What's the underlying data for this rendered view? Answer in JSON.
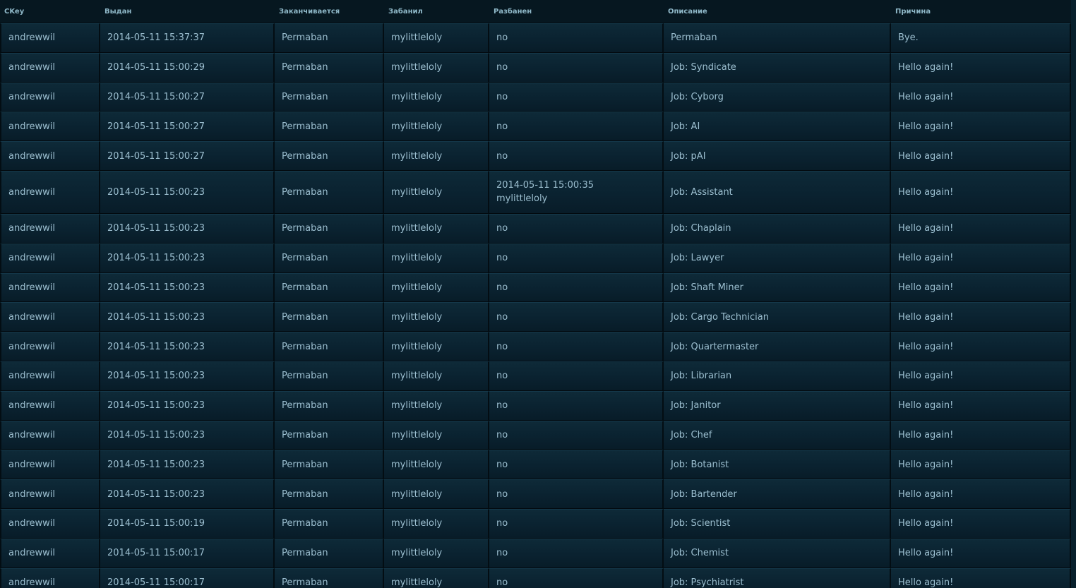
{
  "columns": [
    "CKey",
    "Выдан",
    "Заканчивается",
    "Забанил",
    "Разбанен",
    "Описание",
    "Причина"
  ],
  "rows": [
    {
      "ckey": "andrewwil",
      "issued": "2014-05-11 15:37:37",
      "expires": "Permaban",
      "banned_by": "mylittleloly",
      "unbanned": "no",
      "unbanned_by": "",
      "description": "Permaban",
      "reason": "Bye."
    },
    {
      "ckey": "andrewwil",
      "issued": "2014-05-11 15:00:29",
      "expires": "Permaban",
      "banned_by": "mylittleloly",
      "unbanned": "no",
      "unbanned_by": "",
      "description": "Job: Syndicate",
      "reason": "Hello again!"
    },
    {
      "ckey": "andrewwil",
      "issued": "2014-05-11 15:00:27",
      "expires": "Permaban",
      "banned_by": "mylittleloly",
      "unbanned": "no",
      "unbanned_by": "",
      "description": "Job: Cyborg",
      "reason": "Hello again!"
    },
    {
      "ckey": "andrewwil",
      "issued": "2014-05-11 15:00:27",
      "expires": "Permaban",
      "banned_by": "mylittleloly",
      "unbanned": "no",
      "unbanned_by": "",
      "description": "Job: AI",
      "reason": "Hello again!"
    },
    {
      "ckey": "andrewwil",
      "issued": "2014-05-11 15:00:27",
      "expires": "Permaban",
      "banned_by": "mylittleloly",
      "unbanned": "no",
      "unbanned_by": "",
      "description": "Job: pAI",
      "reason": "Hello again!"
    },
    {
      "ckey": "andrewwil",
      "issued": "2014-05-11 15:00:23",
      "expires": "Permaban",
      "banned_by": "mylittleloly",
      "unbanned": "2014-05-11 15:00:35",
      "unbanned_by": "mylittleloly",
      "description": "Job: Assistant",
      "reason": "Hello again!"
    },
    {
      "ckey": "andrewwil",
      "issued": "2014-05-11 15:00:23",
      "expires": "Permaban",
      "banned_by": "mylittleloly",
      "unbanned": "no",
      "unbanned_by": "",
      "description": "Job: Chaplain",
      "reason": "Hello again!"
    },
    {
      "ckey": "andrewwil",
      "issued": "2014-05-11 15:00:23",
      "expires": "Permaban",
      "banned_by": "mylittleloly",
      "unbanned": "no",
      "unbanned_by": "",
      "description": "Job: Lawyer",
      "reason": "Hello again!"
    },
    {
      "ckey": "andrewwil",
      "issued": "2014-05-11 15:00:23",
      "expires": "Permaban",
      "banned_by": "mylittleloly",
      "unbanned": "no",
      "unbanned_by": "",
      "description": "Job: Shaft Miner",
      "reason": "Hello again!"
    },
    {
      "ckey": "andrewwil",
      "issued": "2014-05-11 15:00:23",
      "expires": "Permaban",
      "banned_by": "mylittleloly",
      "unbanned": "no",
      "unbanned_by": "",
      "description": "Job: Cargo Technician",
      "reason": "Hello again!"
    },
    {
      "ckey": "andrewwil",
      "issued": "2014-05-11 15:00:23",
      "expires": "Permaban",
      "banned_by": "mylittleloly",
      "unbanned": "no",
      "unbanned_by": "",
      "description": "Job: Quartermaster",
      "reason": "Hello again!"
    },
    {
      "ckey": "andrewwil",
      "issued": "2014-05-11 15:00:23",
      "expires": "Permaban",
      "banned_by": "mylittleloly",
      "unbanned": "no",
      "unbanned_by": "",
      "description": "Job: Librarian",
      "reason": "Hello again!"
    },
    {
      "ckey": "andrewwil",
      "issued": "2014-05-11 15:00:23",
      "expires": "Permaban",
      "banned_by": "mylittleloly",
      "unbanned": "no",
      "unbanned_by": "",
      "description": "Job: Janitor",
      "reason": "Hello again!"
    },
    {
      "ckey": "andrewwil",
      "issued": "2014-05-11 15:00:23",
      "expires": "Permaban",
      "banned_by": "mylittleloly",
      "unbanned": "no",
      "unbanned_by": "",
      "description": "Job: Chef",
      "reason": "Hello again!"
    },
    {
      "ckey": "andrewwil",
      "issued": "2014-05-11 15:00:23",
      "expires": "Permaban",
      "banned_by": "mylittleloly",
      "unbanned": "no",
      "unbanned_by": "",
      "description": "Job: Botanist",
      "reason": "Hello again!"
    },
    {
      "ckey": "andrewwil",
      "issued": "2014-05-11 15:00:23",
      "expires": "Permaban",
      "banned_by": "mylittleloly",
      "unbanned": "no",
      "unbanned_by": "",
      "description": "Job: Bartender",
      "reason": "Hello again!"
    },
    {
      "ckey": "andrewwil",
      "issued": "2014-05-11 15:00:19",
      "expires": "Permaban",
      "banned_by": "mylittleloly",
      "unbanned": "no",
      "unbanned_by": "",
      "description": "Job: Scientist",
      "reason": "Hello again!"
    },
    {
      "ckey": "andrewwil",
      "issued": "2014-05-11 15:00:17",
      "expires": "Permaban",
      "banned_by": "mylittleloly",
      "unbanned": "no",
      "unbanned_by": "",
      "description": "Job: Chemist",
      "reason": "Hello again!"
    },
    {
      "ckey": "andrewwil",
      "issued": "2014-05-11 15:00:17",
      "expires": "Permaban",
      "banned_by": "mylittleloly",
      "unbanned": "no",
      "unbanned_by": "",
      "description": "Job: Psychiatrist",
      "reason": "Hello again!"
    }
  ]
}
